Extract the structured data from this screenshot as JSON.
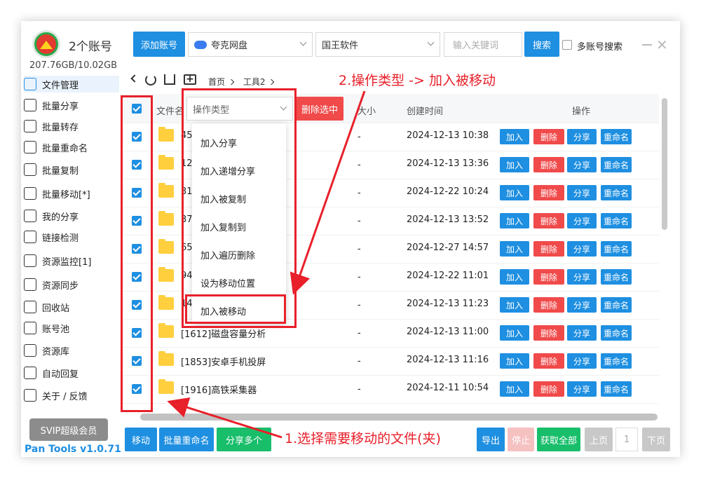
{
  "header": {
    "account_title": "2个账号",
    "capacity": "207.76GB/10.02GB",
    "add_account": "添加账号",
    "drive_select": "夸克网盘",
    "software_select": "国王软件",
    "keyword_placeholder": "输入关键词",
    "search": "搜索",
    "multi_account_search": "多账号搜索"
  },
  "sidebar": {
    "items": [
      {
        "label": "文件管理",
        "icon": "folder-icon"
      },
      {
        "label": "批量分享",
        "icon": "share-icon"
      },
      {
        "label": "批量转存",
        "icon": "transfer-icon"
      },
      {
        "label": "批量重命名",
        "icon": "rename-icon"
      },
      {
        "label": "批量复制",
        "icon": "copy-icon"
      },
      {
        "label": "批量移动[*]",
        "icon": "move-icon"
      },
      {
        "label": "我的分享",
        "icon": "my-share-icon"
      },
      {
        "label": "链接检测",
        "icon": "link-check-icon"
      },
      {
        "label": "资源监控[1]",
        "icon": "monitor-icon"
      },
      {
        "label": "资源同步",
        "icon": "sync-icon"
      },
      {
        "label": "回收站",
        "icon": "trash-icon"
      },
      {
        "label": "账号池",
        "icon": "account-pool-icon"
      },
      {
        "label": "资源库",
        "icon": "library-icon"
      },
      {
        "label": "自动回复",
        "icon": "auto-reply-icon"
      },
      {
        "label": "关于 / 反馈",
        "icon": "bell-icon"
      }
    ],
    "svip": "SVIP超级会员",
    "version": "Pan Tools v1.0.71"
  },
  "breadcrumb": {
    "home": "首页",
    "current": "工具2"
  },
  "table": {
    "headers": {
      "name": "文件名",
      "size": "大小",
      "created": "创建时间",
      "actions": "操作"
    },
    "op_type_placeholder": "操作类型",
    "delete_selected": "删除选中",
    "action_labels": {
      "add": "加入",
      "delete": "删除",
      "share": "分享",
      "rename": "重命名"
    },
    "rows": [
      {
        "name": "45",
        "size": "-",
        "time": "2024-12-13 10:38"
      },
      {
        "name": "12",
        "size": "-",
        "time": "2024-12-13 13:36"
      },
      {
        "name": "31",
        "size": "-",
        "time": "2024-12-22 10:24"
      },
      {
        "name": "37",
        "size": "-",
        "time": "2024-12-13 13:52"
      },
      {
        "name": "65",
        "size": "-",
        "time": "2024-12-27 14:57"
      },
      {
        "name": "94",
        "size": "-",
        "time": "2024-12-22 11:01"
      },
      {
        "name": "14",
        "size": "-",
        "time": "2024-12-13 11:23"
      },
      {
        "name": "[1612]磁盘容量分析",
        "size": "-",
        "time": "2024-12-13 11:00"
      },
      {
        "name": "[1853]安卓手机投屏",
        "size": "-",
        "time": "2024-12-13 11:16"
      },
      {
        "name": "[1916]高铁采集器",
        "size": "-",
        "time": "2024-12-11 10:54"
      }
    ]
  },
  "dropdown": {
    "items": [
      "加入分享",
      "加入递增分享",
      "加入被复制",
      "加入复制到",
      "加入遍历删除",
      "设为移动位置",
      "加入被移动"
    ]
  },
  "footer": {
    "move": "移动",
    "batch_rename": "批量重命名",
    "share_multi": "分享多个",
    "export": "导出",
    "stop": "停止",
    "get_all": "获取全部",
    "prev": "上页",
    "page": "1",
    "next": "下页"
  },
  "annotations": {
    "step1": "1.选择需要移动的文件(夹)",
    "step2": "2.操作类型 -> 加入被移动"
  },
  "colors": {
    "accent": "#1e8fe1",
    "danger": "#f04a4a",
    "success": "#19be6b",
    "annotation": "#e8202a"
  }
}
